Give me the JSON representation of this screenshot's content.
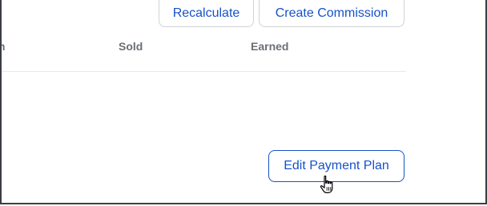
{
  "toolbar": {
    "recalculate_label": "Recalculate",
    "create_commission_label": "Create Commission"
  },
  "table": {
    "columns": [
      "m",
      "Sold",
      "Earned"
    ]
  },
  "actions": {
    "edit_payment_plan_label": "Edit Payment Plan"
  },
  "cursor": {
    "icon": "hand-pointer-cursor-icon"
  },
  "colors": {
    "accent": "#1652c9",
    "header_text": "#6b6f76",
    "border": "#cfd2d6",
    "frame": "#3a3d42"
  }
}
